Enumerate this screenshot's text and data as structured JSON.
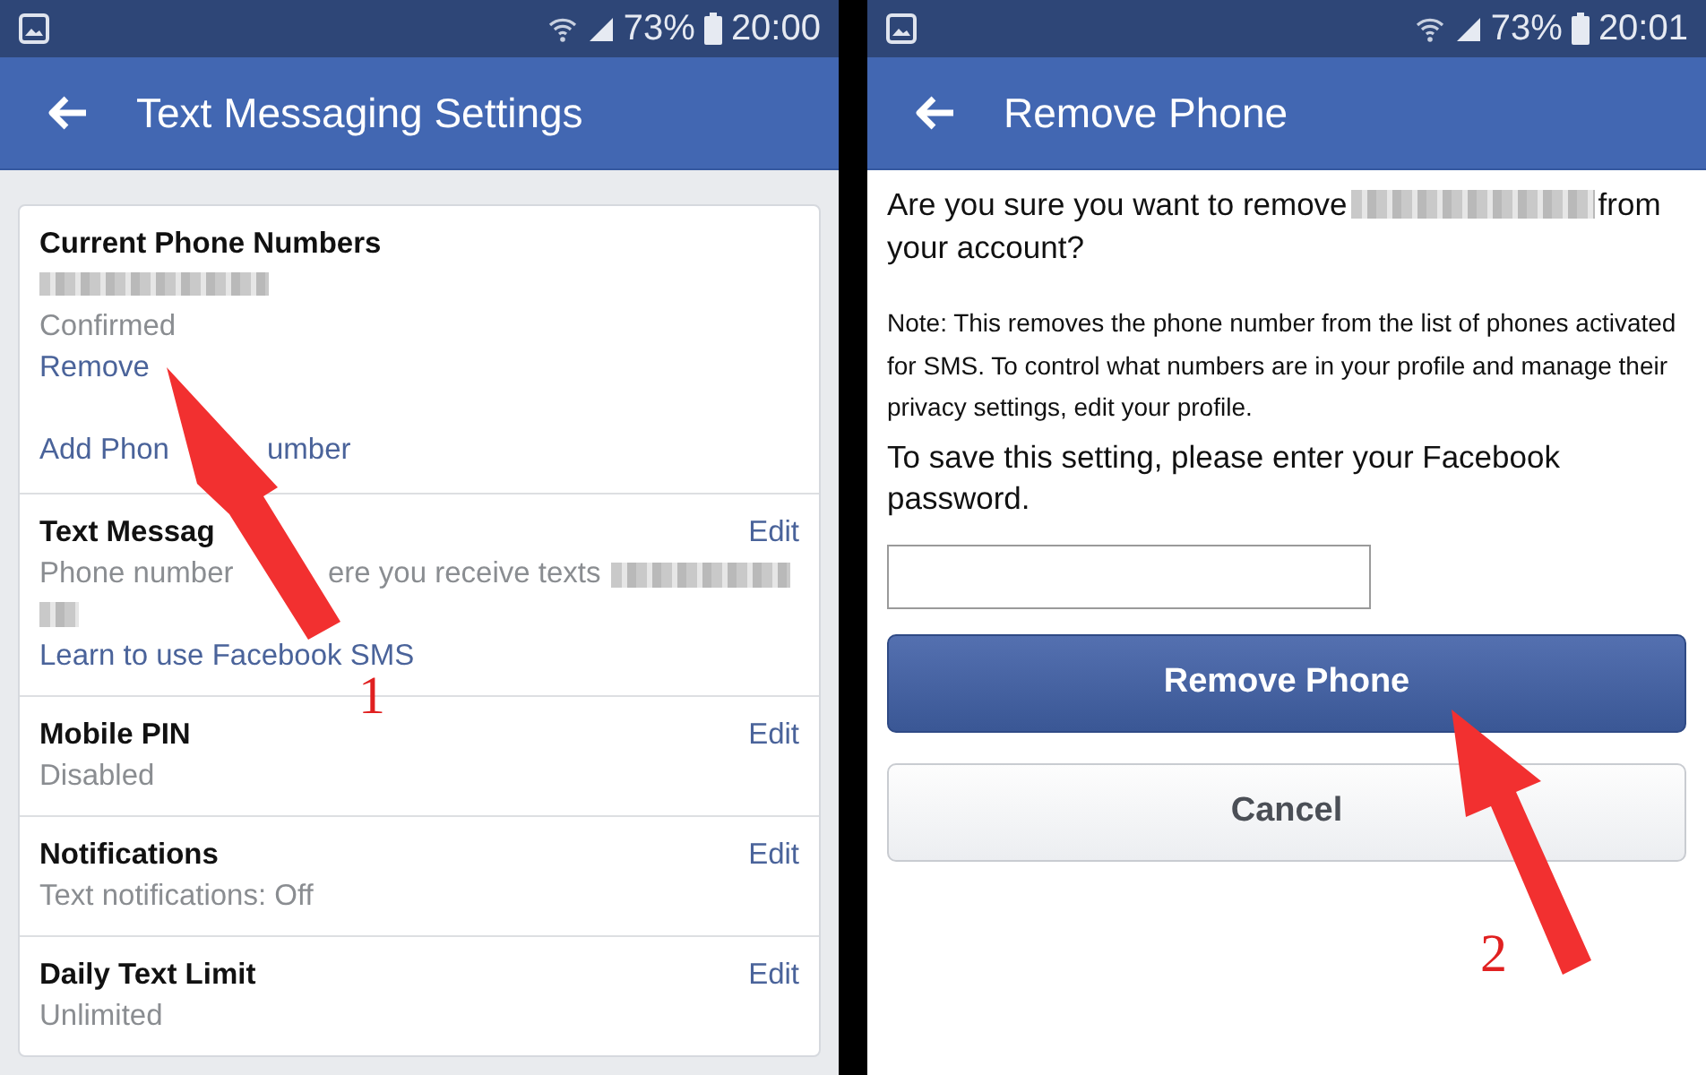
{
  "screens": [
    {
      "status_bar": {
        "battery": "73%",
        "time": "20:00"
      },
      "title": "Text Messaging Settings",
      "kind": "settings",
      "sections": [
        {
          "kind": "phones",
          "title": "Current Phone Numbers",
          "status": "Confirmed",
          "remove_link": "Remove",
          "add_link_parts": [
            "Add Phon",
            "umber"
          ]
        },
        {
          "kind": "setting",
          "title": "Text Messag",
          "edit": "Edit",
          "description_parts": [
            "Phone number",
            "ere you receive texts"
          ],
          "link": "Learn to use Facebook SMS"
        },
        {
          "kind": "setting",
          "title": "Mobile PIN",
          "edit": "Edit",
          "description": "Disabled"
        },
        {
          "kind": "setting",
          "title": "Notifications",
          "edit": "Edit",
          "description": "Text notifications: Off"
        },
        {
          "kind": "setting",
          "title": "Daily Text Limit",
          "edit": "Edit",
          "description": "Unlimited"
        }
      ]
    },
    {
      "status_bar": {
        "battery": "73%",
        "time": "20:01"
      },
      "title": "Remove Phone",
      "kind": "remove",
      "question_start": "Are you sure you want to remove",
      "question_mid": "from",
      "question_end": "your account?",
      "note": "Note: This removes the phone number from the list of phones activated for SMS. To control what numbers are in your profile and manage their privacy settings, edit your profile.",
      "password_prompt": "To save this setting, please enter your Facebook password.",
      "buttons": [
        {
          "kind": "primary",
          "label": "Remove Phone"
        },
        {
          "kind": "secondary",
          "label": "Cancel"
        }
      ]
    }
  ],
  "annotations": [
    {
      "number": "1"
    },
    {
      "number": "2"
    }
  ]
}
